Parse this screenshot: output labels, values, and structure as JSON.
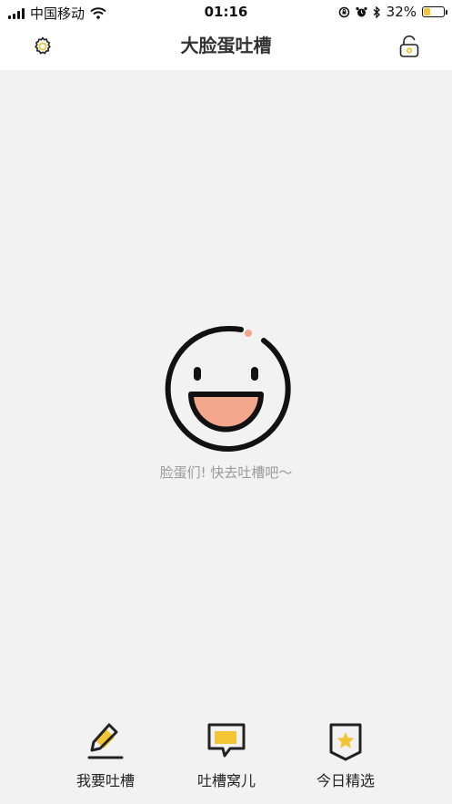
{
  "status_bar": {
    "carrier": "中国移动",
    "time": "01:16",
    "battery_percent": "32%",
    "battery_level": 0.32
  },
  "nav": {
    "title": "大脸蛋吐槽",
    "left_icon": "gear-icon",
    "right_icon": "lock-open-icon"
  },
  "empty_state": {
    "icon": "smiley-face-icon",
    "message": "脸蛋们! 快去吐槽吧～"
  },
  "tabs": [
    {
      "label": "我要吐槽",
      "icon": "pencil-icon"
    },
    {
      "label": "吐槽窝儿",
      "icon": "speech-bubble-icon"
    },
    {
      "label": "今日精选",
      "icon": "star-badge-icon"
    }
  ],
  "colors": {
    "accent_yellow": "#f3c433",
    "face_mouth": "#f3a78c",
    "dark": "#222222",
    "background": "#f2f2f2"
  }
}
